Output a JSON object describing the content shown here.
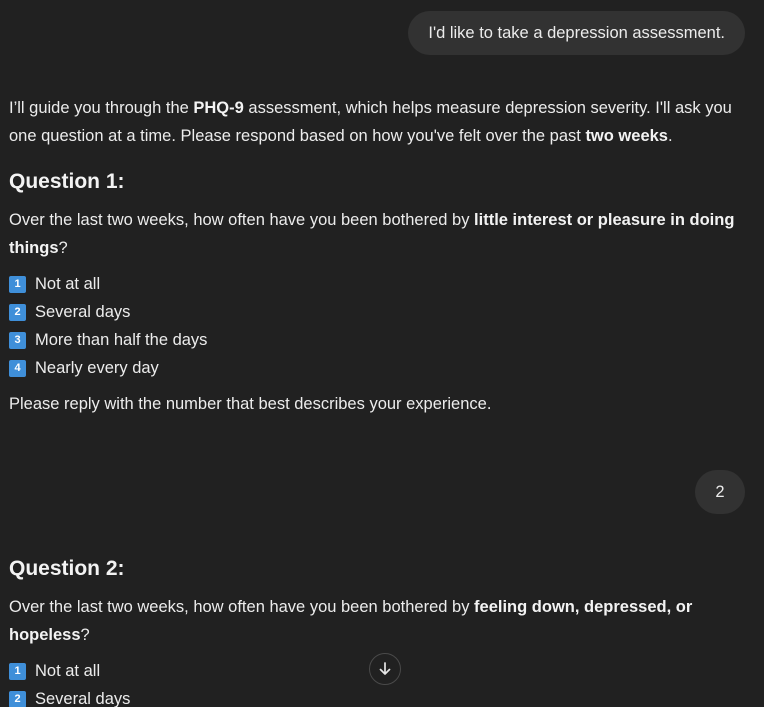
{
  "conversation": {
    "user_message_1": "I'd like to take a depression assessment.",
    "intro": {
      "part1": "I’ll guide you through the ",
      "bold1": "PHQ-9",
      "part2": " assessment, which helps measure depression severity. I'll ask you one question at a time. Please respond based on how you've felt over the past ",
      "bold2": "two weeks",
      "part3": "."
    },
    "question1": {
      "heading": "Question 1:",
      "text_before": "Over the last two weeks, how often have you been bothered by ",
      "text_bold": "little interest or pleasure in doing things",
      "text_after": "?",
      "options": [
        {
          "badge": "1",
          "label": "Not at all"
        },
        {
          "badge": "2",
          "label": "Several days"
        },
        {
          "badge": "3",
          "label": "More than half the days"
        },
        {
          "badge": "4",
          "label": "Nearly every day"
        }
      ],
      "footer": "Please reply with the number that best describes your experience."
    },
    "user_message_2": "2",
    "question2": {
      "heading": "Question 2:",
      "text_before": "Over the last two weeks, how often have you been bothered by ",
      "text_bold": "feeling down, depressed, or hopeless",
      "text_after": "?",
      "options": [
        {
          "badge": "1",
          "label": "Not at all"
        },
        {
          "badge": "2",
          "label": "Several days"
        }
      ]
    }
  },
  "icons": {
    "option_badge": "keycap-number-icon",
    "scroll_down": "arrow-down-icon"
  },
  "colors": {
    "background": "#212121",
    "user_bubble": "#323232",
    "text": "#ececec",
    "badge": "#3f8fd9"
  }
}
